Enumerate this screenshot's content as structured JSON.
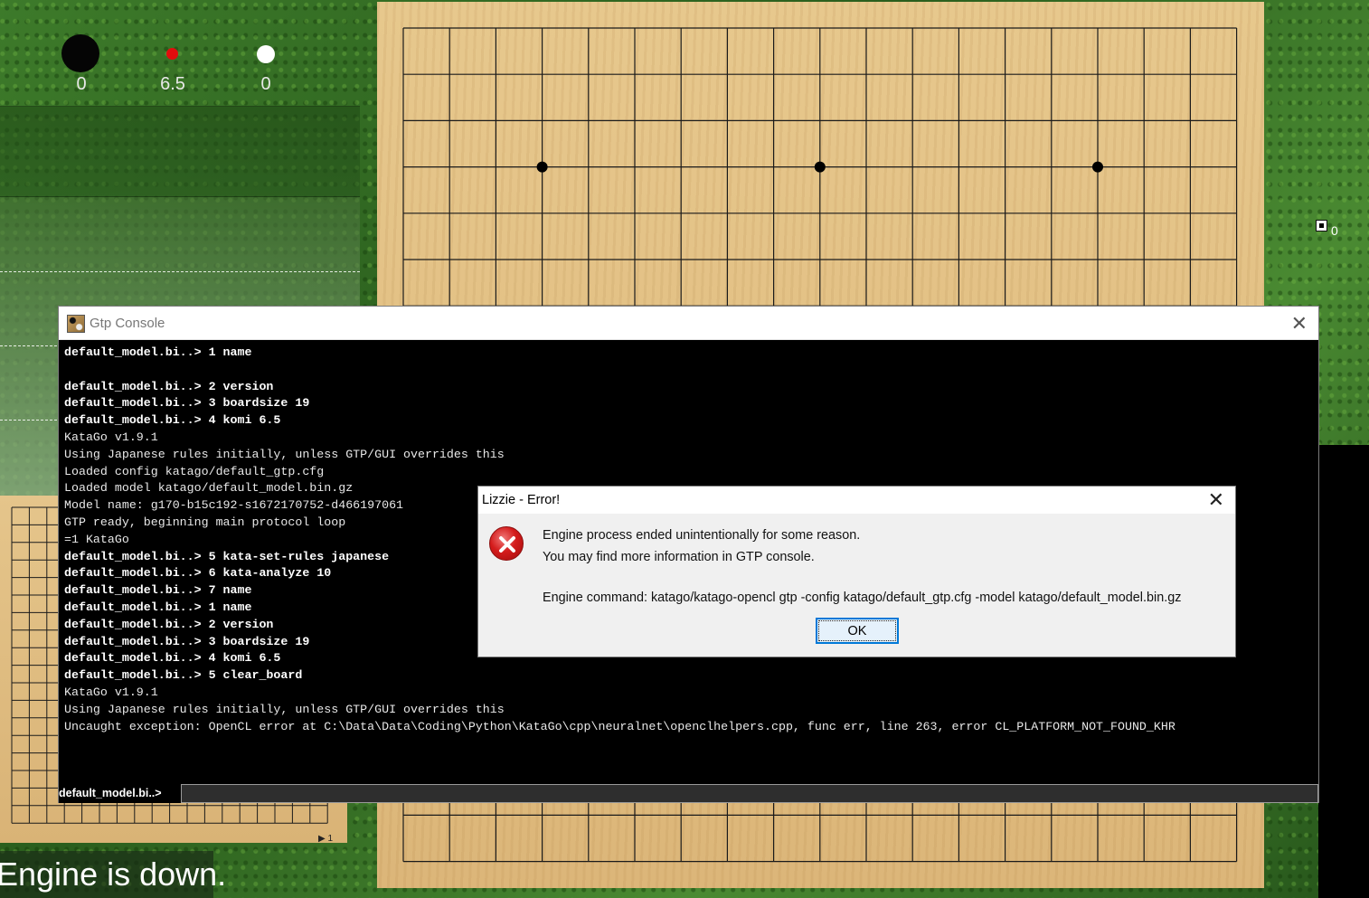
{
  "scoreboard": {
    "black_score": "0",
    "komi": "6.5",
    "white_score": "0"
  },
  "right_panel": {
    "count": "0"
  },
  "mini_board": {
    "label": "▶ 1"
  },
  "status": {
    "text": "Engine is down."
  },
  "gtp_console": {
    "title": "Gtp Console",
    "close_glyph": "✕",
    "lines": [
      {
        "text": "default_model.bi..> 1 name",
        "type": "cmd"
      },
      {
        "text": "",
        "type": "out"
      },
      {
        "text": "default_model.bi..> 2 version",
        "type": "cmd"
      },
      {
        "text": "default_model.bi..> 3 boardsize 19",
        "type": "cmd"
      },
      {
        "text": "default_model.bi..> 4 komi 6.5",
        "type": "cmd"
      },
      {
        "text": "KataGo v1.9.1",
        "type": "out"
      },
      {
        "text": "Using Japanese rules initially, unless GTP/GUI overrides this",
        "type": "out"
      },
      {
        "text": "Loaded config katago/default_gtp.cfg",
        "type": "out"
      },
      {
        "text": "Loaded model katago/default_model.bin.gz",
        "type": "out"
      },
      {
        "text": "Model name: g170-b15c192-s1672170752-d466197061",
        "type": "out"
      },
      {
        "text": "GTP ready, beginning main protocol loop",
        "type": "out"
      },
      {
        "text": "=1 KataGo",
        "type": "out"
      },
      {
        "text": "default_model.bi..> 5 kata-set-rules japanese",
        "type": "cmd"
      },
      {
        "text": "default_model.bi..> 6 kata-analyze 10",
        "type": "cmd"
      },
      {
        "text": "default_model.bi..> 7 name",
        "type": "cmd"
      },
      {
        "text": "default_model.bi..> 1 name",
        "type": "cmd"
      },
      {
        "text": "default_model.bi..> 2 version",
        "type": "cmd"
      },
      {
        "text": "default_model.bi..> 3 boardsize 19",
        "type": "cmd"
      },
      {
        "text": "default_model.bi..> 4 komi 6.5",
        "type": "cmd"
      },
      {
        "text": "default_model.bi..> 5 clear_board",
        "type": "cmd"
      },
      {
        "text": "KataGo v1.9.1",
        "type": "out"
      },
      {
        "text": "Using Japanese rules initially, unless GTP/GUI overrides this",
        "type": "out"
      },
      {
        "text": "Uncaught exception: OpenCL error at C:\\Data\\Data\\Coding\\Python\\KataGo\\cpp\\neuralnet\\openclhelpers.cpp, func err, line 263, error CL_PLATFORM_NOT_FOUND_KHR",
        "type": "out"
      }
    ],
    "prompt": "default_model.bi..>",
    "input_value": ""
  },
  "error_dialog": {
    "title": "Lizzie - Error!",
    "close_glyph": "✕",
    "message_line1": "Engine process ended unintentionally for some reason.",
    "message_line2": "You may find more information in GTP console.",
    "message_line3": "Engine command: katago/katago-opencl gtp -config katago/default_gtp.cfg -model katago/default_model.bin.gz",
    "ok_label": "OK"
  },
  "board": {
    "size": 19,
    "star_points": [
      [
        4,
        4
      ],
      [
        10,
        4
      ],
      [
        16,
        4
      ]
    ]
  },
  "colors": {
    "board_wood": "#e2c185",
    "grass": "#2f6a22",
    "komi_indicator": "#e20d0d",
    "focus_border": "#0078d7"
  }
}
